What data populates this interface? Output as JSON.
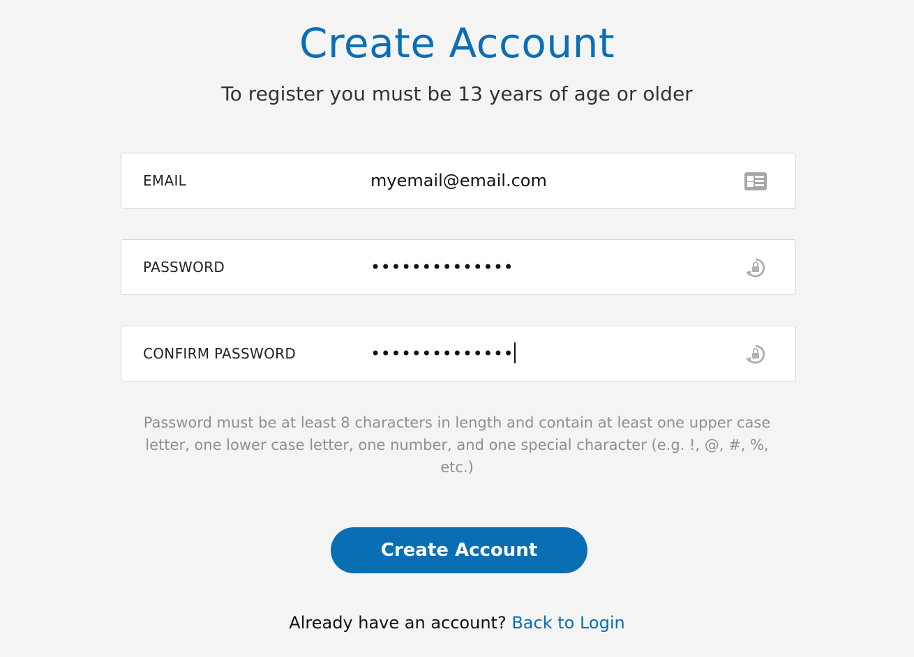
{
  "header": {
    "title": "Create Account",
    "subtitle": "To register you must be 13 years of age or older"
  },
  "form": {
    "email": {
      "label": "EMAIL",
      "value": "myemail@email.com",
      "icon": "contact-card-icon"
    },
    "password": {
      "label": "PASSWORD",
      "value": "••••••••••••••",
      "icon": "lock-refresh-icon"
    },
    "confirm_password": {
      "label": "CONFIRM PASSWORD",
      "value": "••••••••••••••",
      "icon": "lock-refresh-icon"
    },
    "hint": "Password must be at least 8 characters in length and contain at least one upper case letter, one lower case letter, one number, and one special character (e.g. !, @, #, %, etc.)",
    "submit_label": "Create Account"
  },
  "footer": {
    "prompt": "Already have an account?",
    "link_label": "Back to Login"
  },
  "colors": {
    "accent": "#0a6eb5",
    "background": "#f4f4f4",
    "hint_text": "#8f8f8f"
  }
}
